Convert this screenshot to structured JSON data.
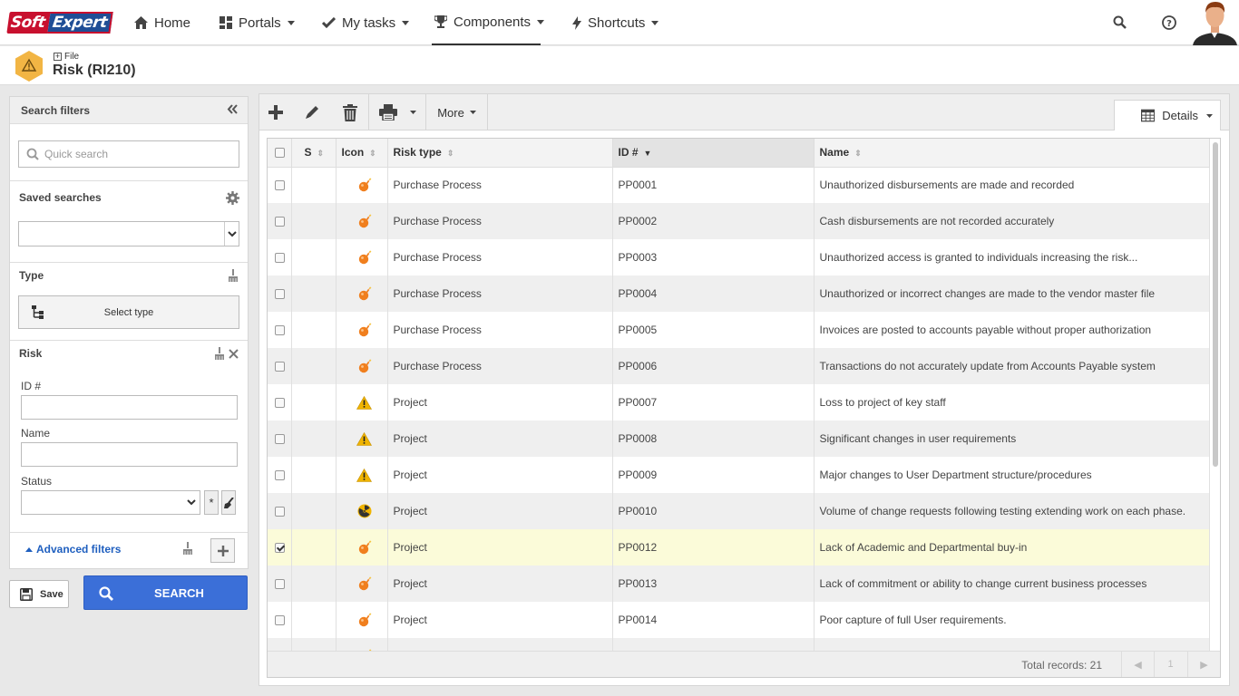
{
  "logo": {
    "part1": "Soft",
    "part2": "Expert"
  },
  "nav": {
    "home": "Home",
    "portals": "Portals",
    "my_tasks": "My tasks",
    "components": "Components",
    "shortcuts": "Shortcuts"
  },
  "header": {
    "breadcrumb": "File",
    "title": "Risk (RI210)"
  },
  "filters": {
    "title": "Search filters",
    "quick_search_placeholder": "Quick search",
    "saved_searches_label": "Saved searches",
    "type_label": "Type",
    "select_type_button": "Select type",
    "risk_section_label": "Risk",
    "id_label": "ID #",
    "name_label": "Name",
    "status_label": "Status",
    "status_asterisk": "*",
    "advanced_filters": "Advanced filters",
    "save_button": "Save",
    "search_button": "SEARCH"
  },
  "toolbar": {
    "more": "More",
    "details": "Details"
  },
  "grid": {
    "columns": {
      "s": "S",
      "icon": "Icon",
      "risk_type": "Risk type",
      "id": "ID #",
      "name": "Name"
    },
    "rows": [
      {
        "checked": false,
        "icon": "bomb-icon",
        "risk_type": "Purchase Process",
        "id": "PP0001",
        "name": "Unauthorized disbursements are made and recorded"
      },
      {
        "checked": false,
        "icon": "bomb-icon",
        "risk_type": "Purchase Process",
        "id": "PP0002",
        "name": "Cash disbursements are not recorded accurately"
      },
      {
        "checked": false,
        "icon": "bomb-icon",
        "risk_type": "Purchase Process",
        "id": "PP0003",
        "name": "Unauthorized access is granted to individuals increasing the risk..."
      },
      {
        "checked": false,
        "icon": "bomb-icon",
        "risk_type": "Purchase Process",
        "id": "PP0004",
        "name": "Unauthorized or incorrect changes are made to the vendor master file"
      },
      {
        "checked": false,
        "icon": "bomb-icon",
        "risk_type": "Purchase Process",
        "id": "PP0005",
        "name": "Invoices are posted to accounts payable without proper authorization"
      },
      {
        "checked": false,
        "icon": "bomb-icon",
        "risk_type": "Purchase Process",
        "id": "PP0006",
        "name": "Transactions do not accurately update from Accounts Payable system"
      },
      {
        "checked": false,
        "icon": "warning-icon",
        "risk_type": "Project",
        "id": "PP0007",
        "name": "Loss to project of key staff"
      },
      {
        "checked": false,
        "icon": "warning-icon",
        "risk_type": "Project",
        "id": "PP0008",
        "name": "Significant changes in user requirements"
      },
      {
        "checked": false,
        "icon": "warning-icon",
        "risk_type": "Project",
        "id": "PP0009",
        "name": "Major changes to User Department structure/procedures"
      },
      {
        "checked": false,
        "icon": "radiation-icon",
        "risk_type": "Project",
        "id": "PP0010",
        "name": "Volume of change requests following testing extending work on each phase."
      },
      {
        "checked": true,
        "icon": "bomb-icon",
        "risk_type": "Project",
        "id": "PP0012",
        "name": "Lack of Academic and Departmental buy-in"
      },
      {
        "checked": false,
        "icon": "bomb-icon",
        "risk_type": "Project",
        "id": "PP0013",
        "name": "Lack of commitment or ability to change current business processes"
      },
      {
        "checked": false,
        "icon": "bomb-icon",
        "risk_type": "Project",
        "id": "PP0014",
        "name": "Poor capture of full User requirements."
      },
      {
        "checked": false,
        "icon": "bomb-icon",
        "risk_type": "",
        "id": "",
        "name": ""
      }
    ],
    "total_records": "Total records: 21",
    "current_page": "1"
  },
  "colors": {
    "accent_blue": "#3b6fd8",
    "selected_row": "#fbfbd9",
    "bomb_orange": "#f07f1e",
    "warning_yellow": "#f0b400"
  }
}
